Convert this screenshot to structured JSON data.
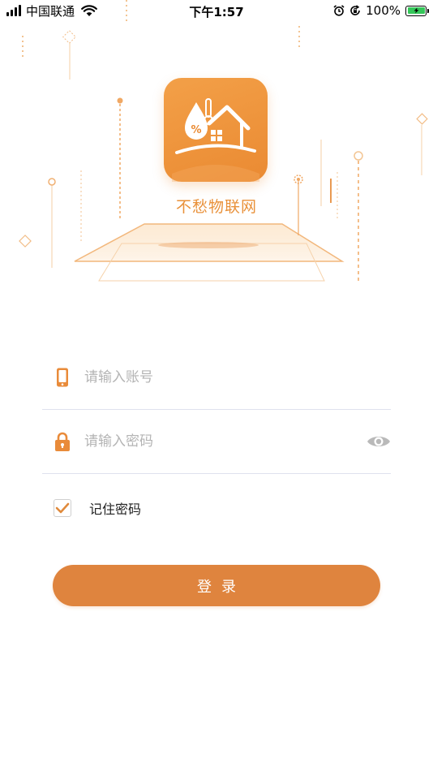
{
  "status_bar": {
    "carrier": "中国联通",
    "time": "下午1:57",
    "battery_percent": "100%",
    "icons": [
      "signal-icon",
      "wifi-icon",
      "alarm-icon",
      "rotation-lock-icon",
      "battery-charging-icon"
    ]
  },
  "brand": {
    "app_name": "不愁物联网",
    "accent_color": "#e9913a",
    "icon_glyph": "%"
  },
  "login_form": {
    "account_placeholder": "请输入账号",
    "account_value": "",
    "password_placeholder": "请输入密码",
    "password_value": "",
    "remember_label": "记住密码",
    "remember_checked": true,
    "login_label": "登录",
    "button_color": "#df843e"
  }
}
